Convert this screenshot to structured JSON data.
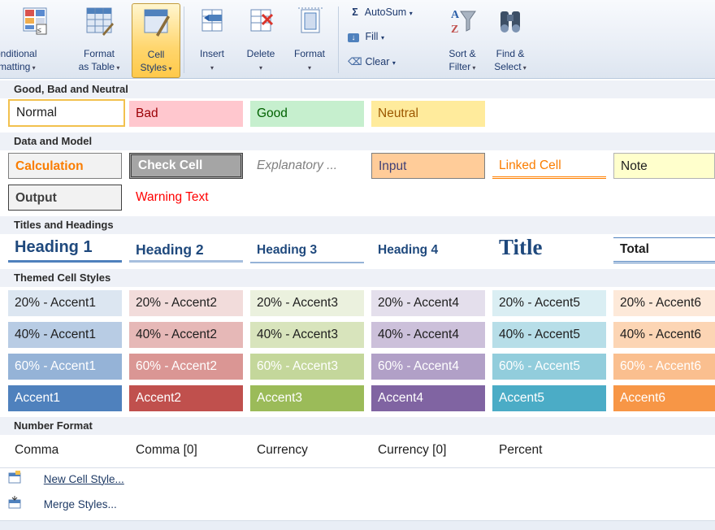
{
  "ribbon": {
    "conditional_formatting": "onditional\nrmatting",
    "format_as_table": "Format\nas Table",
    "cell_styles": "Cell\nStyles",
    "insert": "Insert",
    "delete": "Delete",
    "format": "Format",
    "autosum": "AutoSum",
    "fill": "Fill",
    "clear": "Clear",
    "sort_filter": "Sort &\nFilter",
    "find_select": "Find &\nSelect"
  },
  "sections": {
    "good_bad_neutral": "Good, Bad and Neutral",
    "data_model": "Data and Model",
    "titles_headings": "Titles and Headings",
    "themed": "Themed Cell Styles",
    "number_format": "Number Format"
  },
  "good_bad_neutral": [
    "Normal",
    "Bad",
    "Good",
    "Neutral"
  ],
  "data_model": [
    "Calculation",
    "Check Cell",
    "Explanatory ...",
    "Input",
    "Linked Cell",
    "Note",
    "Output",
    "Warning Text"
  ],
  "titles_headings": [
    "Heading 1",
    "Heading 2",
    "Heading 3",
    "Heading 4",
    "Title",
    "Total"
  ],
  "themed": {
    "row20": [
      "20% - Accent1",
      "20% - Accent2",
      "20% - Accent3",
      "20% - Accent4",
      "20% - Accent5",
      "20% - Accent6"
    ],
    "row40": [
      "40% - Accent1",
      "40% - Accent2",
      "40% - Accent3",
      "40% - Accent4",
      "40% - Accent5",
      "40% - Accent6"
    ],
    "row60": [
      "60% - Accent1",
      "60% - Accent2",
      "60% - Accent3",
      "60% - Accent4",
      "60% - Accent5",
      "60% - Accent6"
    ],
    "accents": [
      "Accent1",
      "Accent2",
      "Accent3",
      "Accent4",
      "Accent5",
      "Accent6"
    ]
  },
  "number_format": [
    "Comma",
    "Comma [0]",
    "Currency",
    "Currency [0]",
    "Percent"
  ],
  "footer": {
    "new_cell_style": "New Cell Style...",
    "merge_styles": "Merge Styles..."
  },
  "colors": {
    "accent1": "#4f81bd",
    "accent2": "#c0504d",
    "accent3": "#9bbb59",
    "accent4": "#8064a2",
    "accent5": "#4bacc6",
    "accent6": "#f79646"
  }
}
